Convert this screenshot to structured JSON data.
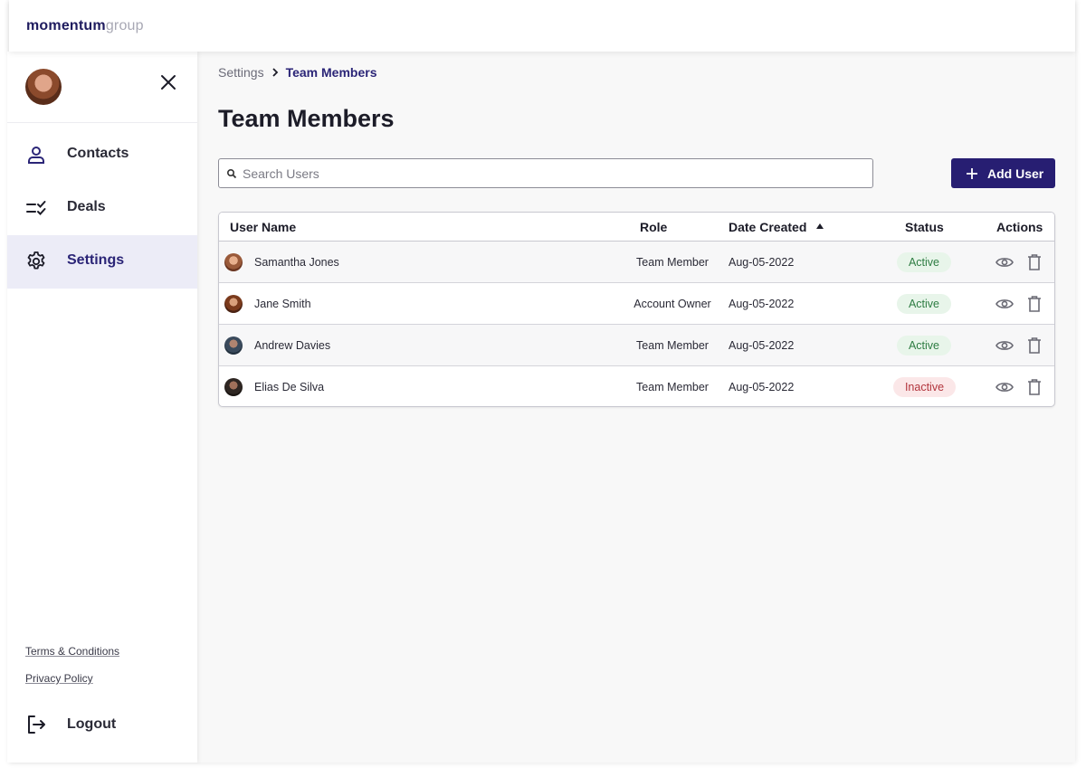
{
  "brand": {
    "logo_bold": "momentum",
    "logo_light": "group"
  },
  "sidebar": {
    "items": [
      {
        "label": "Contacts",
        "icon": "person-icon"
      },
      {
        "label": "Deals",
        "icon": "checklist-icon"
      },
      {
        "label": "Settings",
        "icon": "gear-icon",
        "active": true
      }
    ],
    "footer_links": [
      "Terms & Conditions",
      "Privacy Policy"
    ],
    "logout_label": "Logout"
  },
  "breadcrumb": {
    "root": "Settings",
    "current": "Team Members"
  },
  "page": {
    "title": "Team Members"
  },
  "search": {
    "placeholder": "Search Users",
    "value": ""
  },
  "actions": {
    "add_user_label": "Add User"
  },
  "table": {
    "columns": [
      "User Name",
      "Role",
      "Date Created",
      "Status",
      "Actions"
    ],
    "sort": {
      "column": "Date Created",
      "direction": "ascending"
    },
    "rows": [
      {
        "name": "Samantha Jones",
        "role": "Team Member",
        "date": "Aug-05-2022",
        "status": "Active"
      },
      {
        "name": "Jane Smith",
        "role": "Account Owner",
        "date": "Aug-05-2022",
        "status": "Active"
      },
      {
        "name": "Andrew Davies",
        "role": "Team Member",
        "date": "Aug-05-2022",
        "status": "Active"
      },
      {
        "name": "Elias De Silva",
        "role": "Team Member",
        "date": "Aug-05-2022",
        "status": "Inactive"
      }
    ]
  },
  "colors": {
    "accent": "#271e72",
    "active_nav_bg": "#ececf7",
    "status_active_bg": "#e8f5ea",
    "status_active_text": "#2e7d43",
    "status_inactive_bg": "#fbe7e8",
    "status_inactive_text": "#b2343c"
  }
}
